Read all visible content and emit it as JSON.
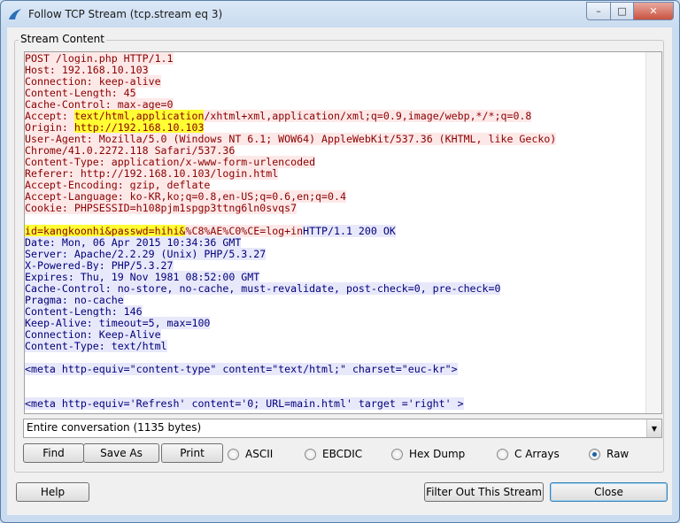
{
  "window": {
    "title": "Follow TCP Stream (tcp.stream eq 3)",
    "minimize_label": "–",
    "maximize_label": "□",
    "close_label": "✕"
  },
  "stream": {
    "group_label": "Stream Content",
    "request_lines": [
      "POST /login.php HTTP/1.1",
      "Host: 192.168.10.103",
      "Connection: keep-alive",
      "Content-Length: 45",
      "Cache-Control: max-age=0",
      "Accept: text/html,application/xhtml+xml,application/xml;q=0.9,image/webp,*/*;q=0.8",
      "Origin: http://192.168.10.103",
      "User-Agent: Mozilla/5.0 (Windows NT 6.1; WOW64) AppleWebKit/537.36 (KHTML, like Gecko)",
      "Chrome/41.0.2272.118 Safari/537.36",
      "Content-Type: application/x-www-form-urlencoded",
      "Referer: http://192.168.10.103/login.html",
      "Accept-Encoding: gzip, deflate",
      "Accept-Language: ko-KR,ko;q=0.8,en-US;q=0.6,en;q=0.4",
      "Cookie: PHPSESSID=h108pjm1spgp3ttng6ln0svqs7"
    ],
    "request_body": "id=kangkoonhi&passwd=hihi&%C8%AE%C0%CE=log+in",
    "response_first_line": "HTTP/1.1 200 OK",
    "response_lines": [
      "Date: Mon, 06 Apr 2015 10:34:36 GMT",
      "Server: Apache/2.2.29 (Unix) PHP/5.3.27",
      "X-Powered-By: PHP/5.3.27",
      "Expires: Thu, 19 Nov 1981 08:52:00 GMT",
      "Cache-Control: no-store, no-cache, must-revalidate, post-check=0, pre-check=0",
      "Pragma: no-cache",
      "Content-Length: 146",
      "Keep-Alive: timeout=5, max=100",
      "Connection: Keep-Alive",
      "Content-Type: text/html"
    ],
    "html_line_1": "<meta http-equiv=\"content-type\" content=\"text/html;\" charset=\"euc-kr\">",
    "html_line_2": "<meta http-equiv='Refresh' content='0; URL=main.html' target ='right' >"
  },
  "conversation_select": {
    "value": "Entire conversation (1135 bytes)"
  },
  "buttons": {
    "find": "Find",
    "save_as": "Save As",
    "print": "Print",
    "help": "Help",
    "filter_out": "Filter Out This Stream",
    "close": "Close"
  },
  "radios": [
    {
      "label": "ASCII",
      "selected": false
    },
    {
      "label": "EBCDIC",
      "selected": false
    },
    {
      "label": "Hex Dump",
      "selected": false
    },
    {
      "label": "C Arrays",
      "selected": false
    },
    {
      "label": "Raw",
      "selected": true
    }
  ],
  "colors": {
    "request_text": "#8b0000",
    "request_bg": "#fde8e8",
    "response_text": "#00007a",
    "response_bg": "#e8e8fb",
    "highlight": "#ffff33"
  }
}
